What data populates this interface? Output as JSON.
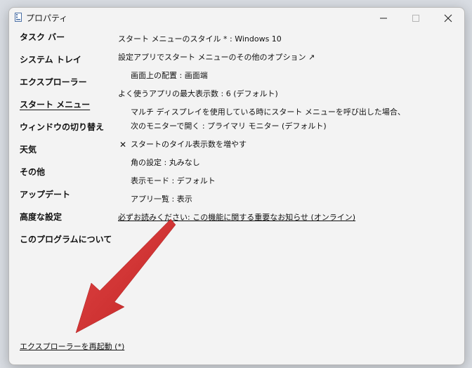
{
  "window": {
    "title": "プロパティ"
  },
  "sidebar": {
    "items": [
      {
        "label": "タスク バー"
      },
      {
        "label": "システム トレイ"
      },
      {
        "label": "エクスプローラー"
      },
      {
        "label": "スタート メニュー"
      },
      {
        "label": "ウィンドウの切り替え"
      },
      {
        "label": "天気"
      },
      {
        "label": "その他"
      },
      {
        "label": "アップデート"
      },
      {
        "label": "高度な設定"
      },
      {
        "label": "このプログラムについて"
      }
    ],
    "active_index": 3
  },
  "content": {
    "start_style": "スタート メニューのスタイル * : Windows 10",
    "settings_app_link": "設定アプリでスタート メニューのその他のオプション ↗",
    "screen_position": "画面上の配置 : 画面端",
    "max_frequent_apps": "よく使うアプリの最大表示数 : 6 (デフォルト)",
    "multi_display_line1": "マルチ ディスプレイを使用している時にスタート メニューを呼び出した場合、",
    "multi_display_line2": "次のモニターで開く : プライマリ モニター (デフォルト)",
    "increase_tiles_mark": "✕",
    "increase_tiles": "スタートのタイル表示数を増やす",
    "corner_setting": "角の設定 : 丸みなし",
    "display_mode": "表示モード : デフォルト",
    "app_list": "アプリ一覧 : 表示",
    "notice_link": "必ずお読みください: この機能に関する重要なお知らせ (オンライン)"
  },
  "footer": {
    "restart_link": "エクスプローラーを再起動 (*)"
  },
  "colors": {
    "annotation_arrow": "#d42a2a",
    "window_bg": "#f3f3f3"
  },
  "icons": [
    "app-icon",
    "minimize-icon",
    "maximize-icon",
    "close-icon",
    "annotation-arrow-icon"
  ]
}
